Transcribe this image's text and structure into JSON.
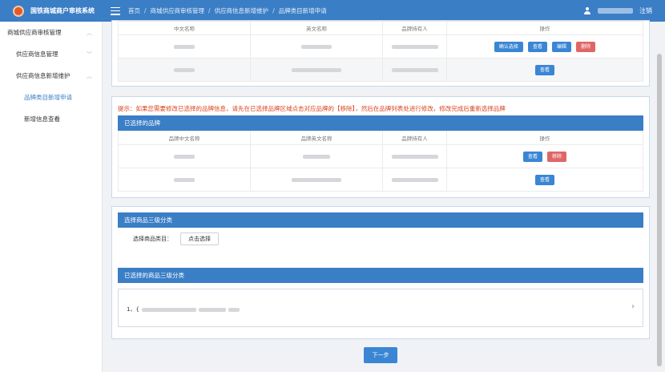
{
  "app": {
    "title": "国铁商城商户审核系统"
  },
  "breadcrumb": [
    "首页",
    "商城供应商审核管理",
    "供应商信息新增维护",
    "品牌类目新增申请"
  ],
  "user": {
    "logout_label": "注销"
  },
  "sidebar": {
    "items": [
      {
        "label": "商城供应商审核管理"
      },
      {
        "label": "供应商信息管理"
      },
      {
        "label": "供应商信息新增维护"
      },
      {
        "label": "品牌类目新增申请"
      },
      {
        "label": "新增信息查看"
      }
    ]
  },
  "brand_table": {
    "headers": [
      "中文名称",
      "英文名称",
      "品牌持有人",
      "操作"
    ],
    "rows": [
      {
        "actions": [
          "确认选择",
          "查看",
          "编辑",
          "删除"
        ]
      },
      {
        "actions": [
          "查看"
        ]
      }
    ]
  },
  "hint": "提示：如果您需要修改已选择的品牌信息，请先在已选择品牌区域点击对应品牌的【移除】，然后在品牌列表处进行修改，修改完成后重新选择品牌",
  "selected_brands": {
    "title": "已选择的品牌",
    "headers": [
      "品牌中文名称",
      "品牌英文名称",
      "品牌持有人",
      "操作"
    ],
    "rows": [
      {
        "actions": [
          "查看",
          "移除"
        ]
      },
      {
        "actions": [
          "查看"
        ]
      }
    ]
  },
  "category": {
    "title": "选择商品三级分类",
    "field_label": "选择商品类目：",
    "choose_button": "点击选择",
    "selected_title": "已选择的商品三级分类",
    "item_prefix": "1、{"
  },
  "next_button": "下一步",
  "colors": {
    "primary": "#3a7ec6",
    "danger": "#e06666",
    "hint": "#d9431f"
  }
}
